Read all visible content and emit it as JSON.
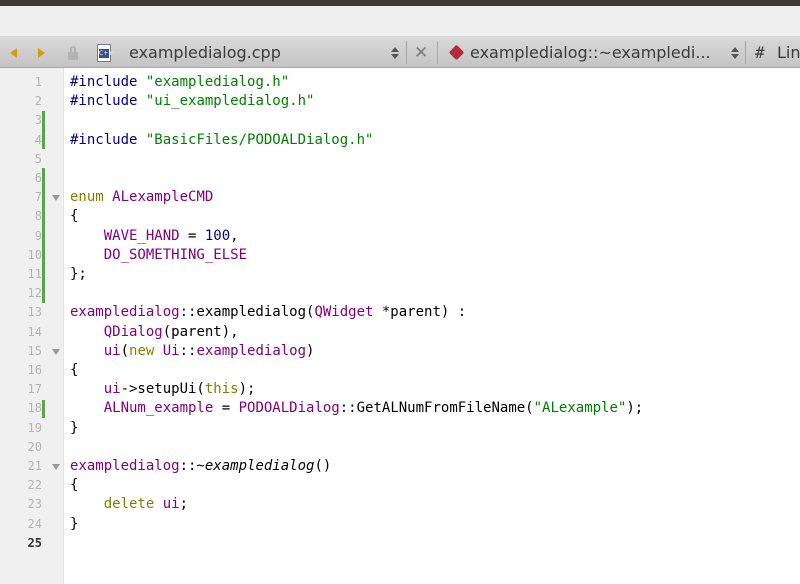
{
  "toolbar": {
    "file_name": "exampledialog.cpp",
    "symbol": "exampledialog::~exampledi...",
    "hash": "#",
    "extra": "Lin",
    "close": "✕",
    "file_badge": "C++"
  },
  "editor": {
    "current_line": 25,
    "lines": [
      {
        "n": "1",
        "tokens": [
          {
            "c": "pre",
            "t": "#include"
          },
          {
            "c": "",
            "t": " "
          },
          {
            "c": "str",
            "t": "\"exampledialog.h\""
          }
        ]
      },
      {
        "n": "2",
        "tokens": [
          {
            "c": "pre",
            "t": "#include"
          },
          {
            "c": "",
            "t": " "
          },
          {
            "c": "str",
            "t": "\"ui_exampledialog.h\""
          }
        ]
      },
      {
        "n": "3",
        "tokens": []
      },
      {
        "n": "4",
        "tokens": [
          {
            "c": "pre",
            "t": "#include"
          },
          {
            "c": "",
            "t": " "
          },
          {
            "c": "str",
            "t": "\"BasicFiles/PODOALDialog.h\""
          }
        ]
      },
      {
        "n": "5",
        "tokens": []
      },
      {
        "n": "6",
        "tokens": []
      },
      {
        "n": "7",
        "fold": true,
        "tokens": [
          {
            "c": "kw",
            "t": "enum"
          },
          {
            "c": "",
            "t": " "
          },
          {
            "c": "typ",
            "t": "ALexampleCMD"
          }
        ]
      },
      {
        "n": "8",
        "tokens": [
          {
            "c": "",
            "t": "{"
          }
        ]
      },
      {
        "n": "9",
        "tokens": [
          {
            "c": "",
            "t": "    "
          },
          {
            "c": "enum",
            "t": "WAVE_HAND"
          },
          {
            "c": "",
            "t": " = "
          },
          {
            "c": "num",
            "t": "100"
          },
          {
            "c": "",
            "t": ","
          }
        ]
      },
      {
        "n": "10",
        "tokens": [
          {
            "c": "",
            "t": "    "
          },
          {
            "c": "enum",
            "t": "DO_SOMETHING_ELSE"
          }
        ]
      },
      {
        "n": "11",
        "tokens": [
          {
            "c": "",
            "t": "};"
          }
        ]
      },
      {
        "n": "12",
        "tokens": []
      },
      {
        "n": "13",
        "tokens": [
          {
            "c": "typ",
            "t": "exampledialog"
          },
          {
            "c": "",
            "t": "::exampledialog("
          },
          {
            "c": "typ",
            "t": "QWidget"
          },
          {
            "c": "",
            "t": " *parent) :"
          }
        ]
      },
      {
        "n": "14",
        "tokens": [
          {
            "c": "",
            "t": "    "
          },
          {
            "c": "typ",
            "t": "QDialog"
          },
          {
            "c": "",
            "t": "(parent),"
          }
        ]
      },
      {
        "n": "15",
        "fold": true,
        "tokens": [
          {
            "c": "",
            "t": "    "
          },
          {
            "c": "enum",
            "t": "ui"
          },
          {
            "c": "",
            "t": "("
          },
          {
            "c": "kw",
            "t": "new"
          },
          {
            "c": "",
            "t": " "
          },
          {
            "c": "typ",
            "t": "Ui"
          },
          {
            "c": "",
            "t": "::"
          },
          {
            "c": "typ",
            "t": "exampledialog"
          },
          {
            "c": "",
            "t": ")"
          }
        ]
      },
      {
        "n": "16",
        "tokens": [
          {
            "c": "",
            "t": "{"
          }
        ]
      },
      {
        "n": "17",
        "tokens": [
          {
            "c": "",
            "t": "    "
          },
          {
            "c": "enum",
            "t": "ui"
          },
          {
            "c": "",
            "t": "->setupUi("
          },
          {
            "c": "kw",
            "t": "this"
          },
          {
            "c": "",
            "t": ");"
          }
        ]
      },
      {
        "n": "18",
        "tokens": [
          {
            "c": "",
            "t": "    "
          },
          {
            "c": "enum",
            "t": "ALNum_example"
          },
          {
            "c": "",
            "t": " = "
          },
          {
            "c": "typ",
            "t": "PODOALDialog"
          },
          {
            "c": "",
            "t": "::GetALNumFromFileName("
          },
          {
            "c": "str",
            "t": "\"ALexample\""
          },
          {
            "c": "",
            "t": ");"
          }
        ]
      },
      {
        "n": "19",
        "tokens": [
          {
            "c": "",
            "t": "}"
          }
        ]
      },
      {
        "n": "20",
        "tokens": []
      },
      {
        "n": "21",
        "fold": true,
        "tokens": [
          {
            "c": "typ",
            "t": "exampledialog"
          },
          {
            "c": "",
            "t": "::~"
          },
          {
            "c": "it",
            "t": "exampledialog"
          },
          {
            "c": "",
            "t": "()"
          }
        ]
      },
      {
        "n": "22",
        "tokens": [
          {
            "c": "",
            "t": "{"
          }
        ]
      },
      {
        "n": "23",
        "tokens": [
          {
            "c": "",
            "t": "    "
          },
          {
            "c": "kw",
            "t": "delete"
          },
          {
            "c": "",
            "t": " "
          },
          {
            "c": "enum",
            "t": "ui"
          },
          {
            "c": "",
            "t": ";"
          }
        ]
      },
      {
        "n": "24",
        "tokens": [
          {
            "c": "",
            "t": "}"
          }
        ]
      },
      {
        "n": "25",
        "tokens": []
      }
    ]
  }
}
